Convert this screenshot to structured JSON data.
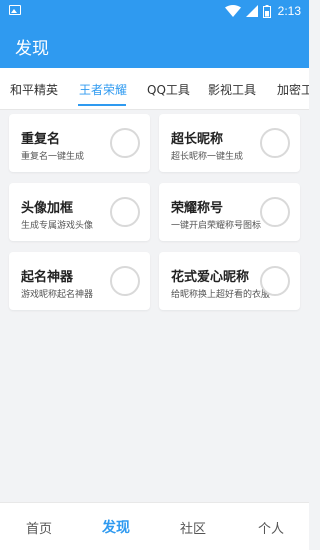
{
  "status_bar": {
    "time": "2:13",
    "icons": [
      "image-icon",
      "wifi-icon",
      "signal-icon",
      "battery-icon"
    ]
  },
  "app_bar": {
    "title": "发现"
  },
  "tabs": [
    {
      "label": "和平精英",
      "active": false
    },
    {
      "label": "王者荣耀",
      "active": true
    },
    {
      "label": "QQ工具",
      "active": false
    },
    {
      "label": "影视工具",
      "active": false
    },
    {
      "label": "加密工",
      "active": false
    }
  ],
  "cards": [
    {
      "title": "重复名",
      "desc": "重复名一键生成"
    },
    {
      "title": "超长昵称",
      "desc": "超长昵称一键生成"
    },
    {
      "title": "头像加框",
      "desc": "生成专属游戏头像"
    },
    {
      "title": "荣耀称号",
      "desc": "一键开启荣耀称号图标"
    },
    {
      "title": "起名神器",
      "desc": "游戏昵称起名神器"
    },
    {
      "title": "花式爱心昵称",
      "desc": "给昵称换上超好看的衣服"
    }
  ],
  "bottom_nav": [
    {
      "label": "首页",
      "active": false
    },
    {
      "label": "发现",
      "active": true
    },
    {
      "label": "社区",
      "active": false
    },
    {
      "label": "个人",
      "active": false
    }
  ],
  "colors": {
    "primary": "#2f9af0",
    "background": "#f2f3f5",
    "card": "#ffffff"
  }
}
